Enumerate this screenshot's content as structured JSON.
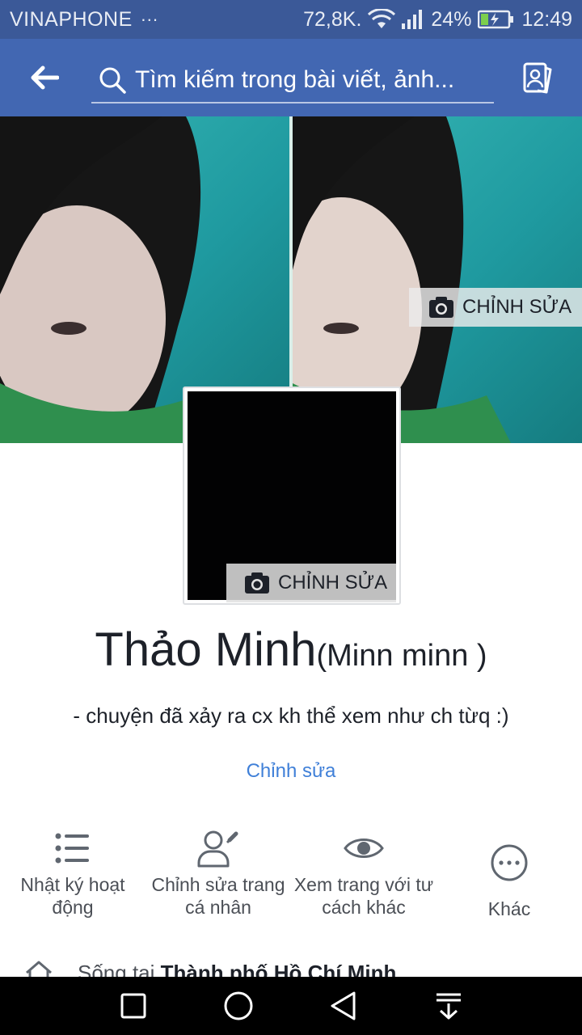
{
  "status_bar": {
    "carrier": "VINAPHONE",
    "overflow": "···",
    "data_rate": "72,8K.",
    "battery": "24%",
    "time": "12:49",
    "icons": [
      "wifi-icon",
      "signal-icon",
      "battery-charging-icon"
    ]
  },
  "header": {
    "back_icon": "arrow-left-icon",
    "search_placeholder": "Tìm kiếm trong bài viết, ảnh...",
    "profile_switch_icon": "profile-switch-icon"
  },
  "cover": {
    "edit_label": "CHỈNH SỬA",
    "edit_icon": "camera-icon"
  },
  "avatar": {
    "edit_label": "CHỈNH SỬA",
    "edit_icon": "camera-icon"
  },
  "profile": {
    "name": "Thảo Minh",
    "alternate_name": "(Minn minn )",
    "bio": "- chuyện đã xảy ra cx kh thể xem như ch từq :)",
    "edit_bio_label": "Chỉnh sửa"
  },
  "actions": [
    {
      "label": "Nhật ký hoạt động",
      "icon": "activity-log-icon"
    },
    {
      "label": "Chỉnh sửa trang cá nhân",
      "icon": "edit-profile-icon"
    },
    {
      "label": "Xem trang với tư cách khác",
      "icon": "view-as-icon"
    },
    {
      "label": "Khác",
      "icon": "more-icon"
    }
  ],
  "lives_in": {
    "prefix": "Sống tại",
    "city": "Thành phố Hồ Chí Minh",
    "icon": "home-icon"
  },
  "nav_bar": {
    "icons": [
      "recent-apps-icon",
      "home-circle-icon",
      "back-triangle-icon",
      "notifications-pull-icon"
    ]
  },
  "colors": {
    "header": "#4267b2",
    "status_bar": "#3b5998",
    "link": "#4080d8",
    "cover_teal": "#2aa3a6"
  }
}
